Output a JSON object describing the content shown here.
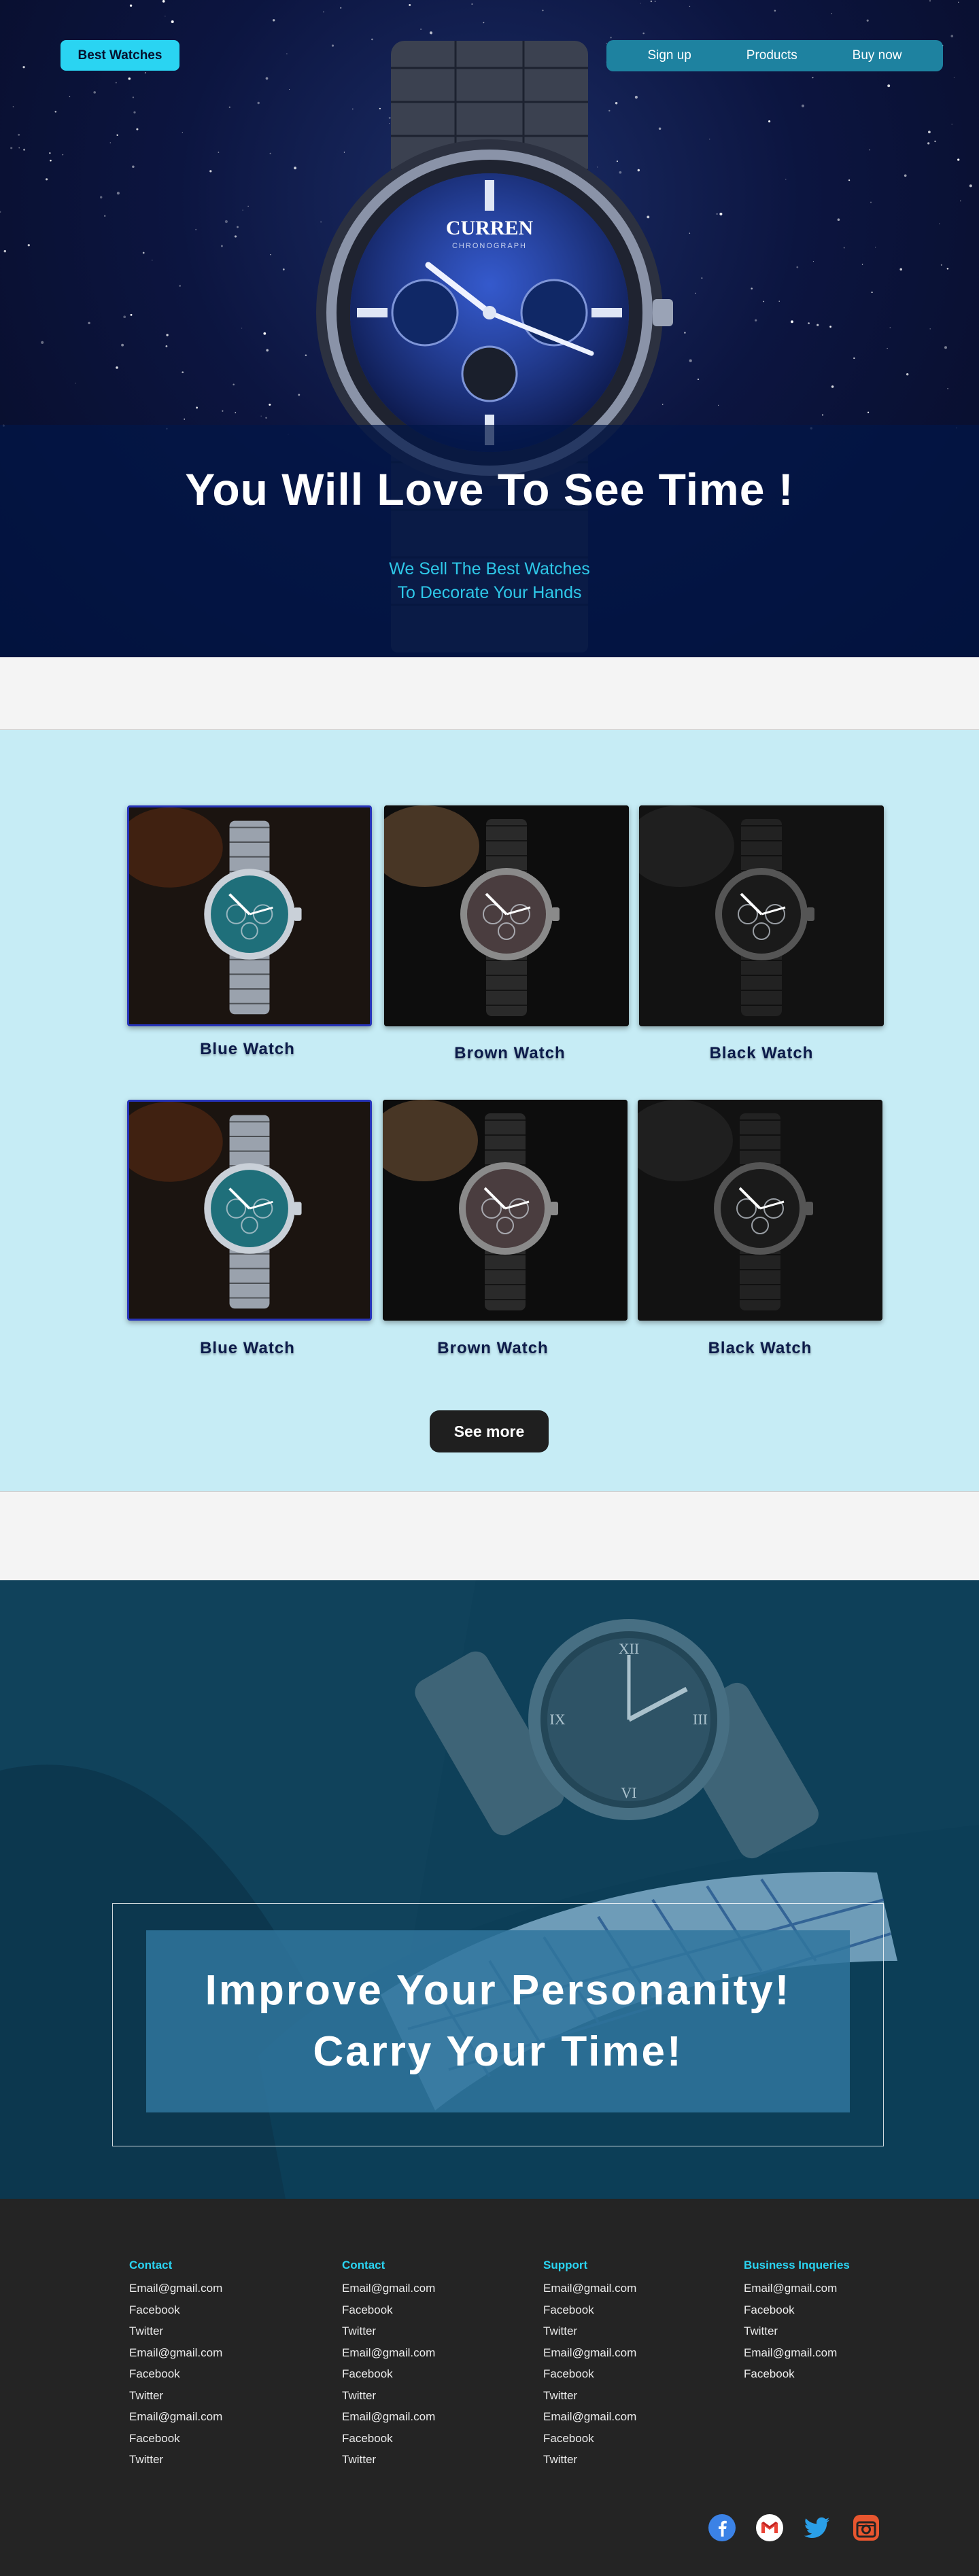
{
  "header": {
    "brand": "Best Watches",
    "nav": [
      "Sign up",
      "Products",
      "Buy now"
    ]
  },
  "hero": {
    "title": "You Will Love To See Time !",
    "subtitle_line1": "We Sell The Best Watches",
    "subtitle_line2": "To Decorate Your Hands",
    "watch_brand": "CURREN",
    "watch_sub": "CHRONOGRAPH"
  },
  "products": {
    "items": [
      {
        "name": "Blue Watch",
        "variant": "blue"
      },
      {
        "name": "Brown Watch",
        "variant": "brown"
      },
      {
        "name": "Black Watch",
        "variant": "black"
      },
      {
        "name": "Blue Watch",
        "variant": "blue"
      },
      {
        "name": "Brown Watch",
        "variant": "brown"
      },
      {
        "name": "Black Watch",
        "variant": "black"
      }
    ],
    "see_more": "See more"
  },
  "promo": {
    "line1": "Improve Your Personanity!",
    "line2": "Carry Your Time!"
  },
  "footer": {
    "columns": [
      {
        "title": "Contact",
        "items": [
          "Email@gmail.com",
          "Facebook",
          "Twitter",
          "Email@gmail.com",
          "Facebook",
          "Twitter",
          "Email@gmail.com",
          "Facebook",
          "Twitter"
        ]
      },
      {
        "title": "Contact",
        "items": [
          "Email@gmail.com",
          "Facebook",
          "Twitter",
          "Email@gmail.com",
          "Facebook",
          "Twitter",
          "Email@gmail.com",
          "Facebook",
          "Twitter"
        ]
      },
      {
        "title": "Support",
        "items": [
          "Email@gmail.com",
          "Facebook",
          "Twitter",
          "Email@gmail.com",
          "Facebook",
          "Twitter",
          "Email@gmail.com",
          "Facebook",
          "Twitter"
        ]
      },
      {
        "title": "Business Inqueries",
        "items": [
          "Email@gmail.com",
          "Facebook",
          "Twitter",
          "Email@gmail.com",
          "Facebook"
        ]
      }
    ],
    "social": [
      "facebook-icon",
      "gmail-icon",
      "twitter-icon",
      "instagram-icon"
    ]
  },
  "colors": {
    "accent": "#2ad4f2",
    "products_bg": "#c6ecf5",
    "footer_bg": "#242424",
    "caption": "#0c1b4a"
  }
}
